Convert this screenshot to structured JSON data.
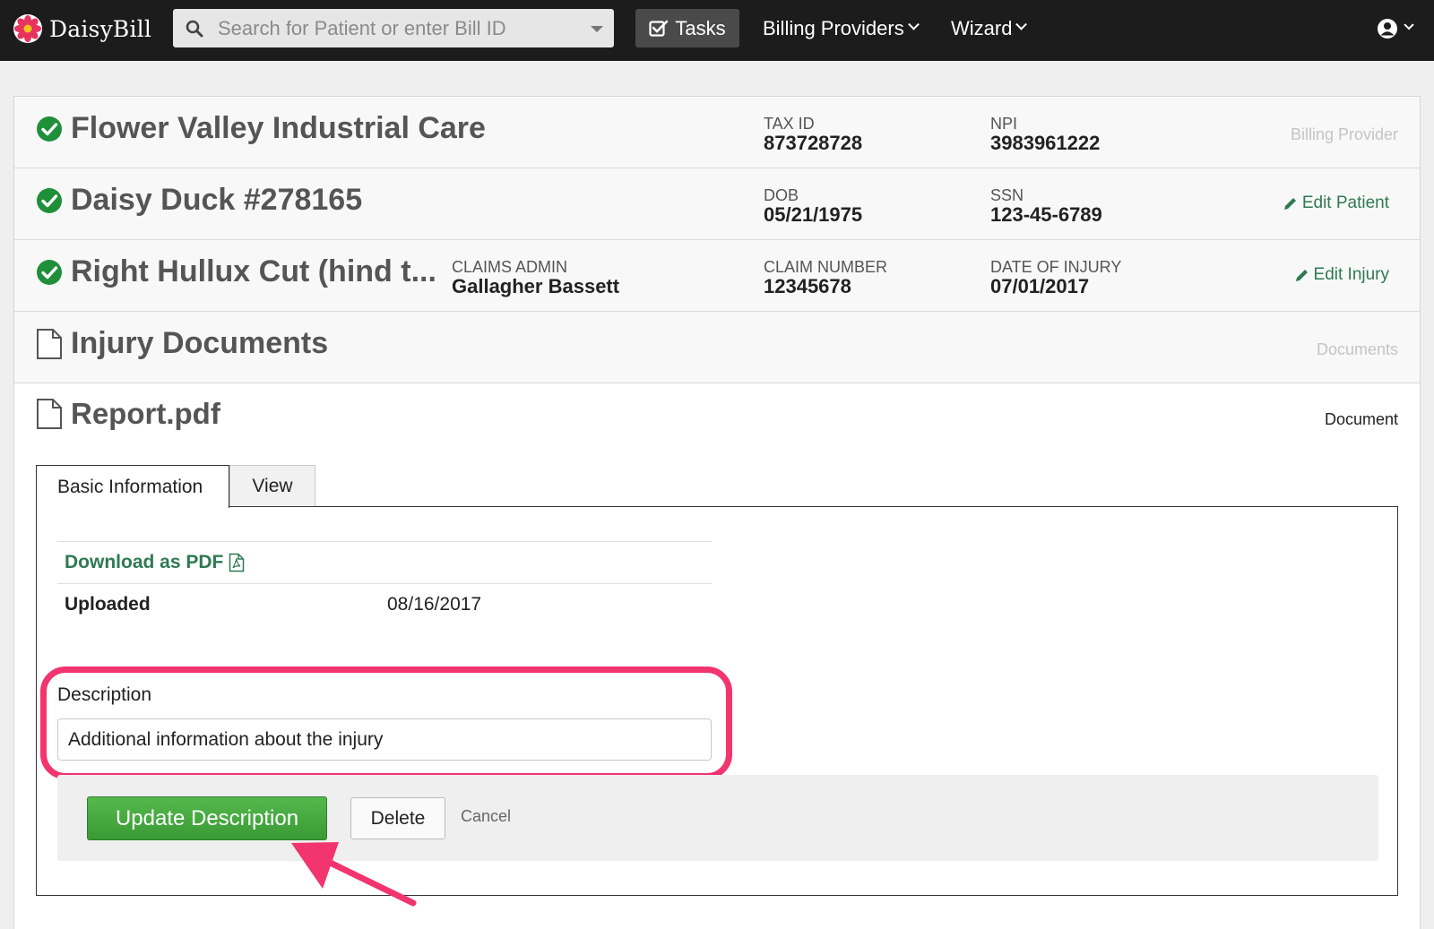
{
  "nav": {
    "brand": "DaisyBill",
    "search_placeholder": "Search for Patient or enter Bill ID",
    "tasks": "Tasks",
    "billing_providers": "Billing Providers",
    "wizard": "Wizard"
  },
  "provider": {
    "name": "Flower Valley Industrial Care",
    "tax_id_label": "TAX ID",
    "tax_id": "873728728",
    "npi_label": "NPI",
    "npi": "3983961222",
    "section": "Billing Provider"
  },
  "patient": {
    "name": "Daisy Duck #278165",
    "dob_label": "DOB",
    "dob": "05/21/1975",
    "ssn_label": "SSN",
    "ssn": "123-45-6789",
    "action": "Edit Patient"
  },
  "injury": {
    "name": "Right Hullux Cut (hind t...",
    "admin_label": "CLAIMS ADMIN",
    "admin": "Gallagher Bassett",
    "claim_label": "CLAIM NUMBER",
    "claim": "12345678",
    "doi_label": "DATE OF INJURY",
    "doi": "07/01/2017",
    "action": "Edit Injury"
  },
  "documents": {
    "title": "Injury Documents",
    "section": "Documents"
  },
  "document": {
    "name": "Report.pdf",
    "type": "Document",
    "tabs": [
      "Basic Information",
      "View"
    ],
    "download": "Download as PDF",
    "uploaded_label": "Uploaded",
    "uploaded": "08/16/2017",
    "description_label": "Description",
    "description": "Additional information about the injury",
    "update_button": "Update Description",
    "delete_button": "Delete",
    "cancel": "Cancel"
  },
  "colors": {
    "nav_bg": "#1c1c1c",
    "accent_green": "#2f7a52",
    "button_green": "#3a9a34",
    "highlight": "#f2346f"
  }
}
